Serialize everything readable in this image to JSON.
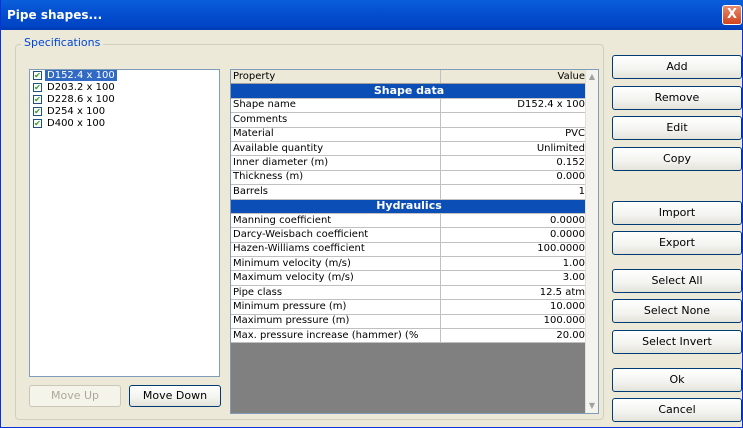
{
  "window": {
    "title": "Pipe shapes...",
    "close_glyph": "X"
  },
  "group": {
    "label": "Specifications"
  },
  "shape_list": [
    {
      "label": "D152.4 x 100",
      "checked": true,
      "selected": true
    },
    {
      "label": "D203.2 x 100",
      "checked": true,
      "selected": false
    },
    {
      "label": "D228.6 x 100",
      "checked": true,
      "selected": false
    },
    {
      "label": "D254 x 100",
      "checked": true,
      "selected": false
    },
    {
      "label": "D400 x 100",
      "checked": true,
      "selected": false
    }
  ],
  "list_buttons": {
    "move_up": "Move Up",
    "move_down": "Move Down"
  },
  "grid": {
    "header": {
      "property": "Property",
      "value": "Value"
    },
    "rows": [
      {
        "section": "Shape data"
      },
      {
        "property": "Shape name",
        "value": "D152.4 x 100"
      },
      {
        "property": "Comments",
        "value": ""
      },
      {
        "property": "Material",
        "value": "PVC"
      },
      {
        "property": "Available quantity",
        "value": "Unlimited"
      },
      {
        "property": "Inner diameter (m)",
        "value": "0.152"
      },
      {
        "property": "Thickness (m)",
        "value": "0.000"
      },
      {
        "property": "Barrels",
        "value": "1"
      },
      {
        "section": "Hydraulics"
      },
      {
        "property": "Manning coefficient",
        "value": "0.0000"
      },
      {
        "property": "Darcy-Weisbach coefficient",
        "value": "0.0000"
      },
      {
        "property": "Hazen-Williams coefficient",
        "value": "100.0000"
      },
      {
        "property": "Minimum velocity (m/s)",
        "value": "1.00"
      },
      {
        "property": "Maximum velocity (m/s)",
        "value": "3.00"
      },
      {
        "property": "Pipe class",
        "value": "12.5 atm"
      },
      {
        "property": "Minimum pressure (m)",
        "value": "10.000"
      },
      {
        "property": "Maximum pressure (m)",
        "value": "100.000"
      },
      {
        "property": "Max. pressure increase (hammer) (%",
        "value": "20.00"
      }
    ]
  },
  "side_buttons": {
    "add": "Add",
    "remove": "Remove",
    "edit": "Edit",
    "copy": "Copy",
    "import": "Import",
    "export": "Export",
    "select_all": "Select All",
    "select_none": "Select None",
    "select_invert": "Select Invert",
    "ok": "Ok",
    "cancel": "Cancel"
  },
  "icons": {
    "check": "check-icon",
    "scroll_up": "scroll-up-arrow-icon",
    "scroll_down": "scroll-down-arrow-icon"
  },
  "colors": {
    "titlebar": "#0A5FDB",
    "section_header": "#0A4EB6",
    "selection": "#316AC5",
    "group_label": "#0046D5"
  }
}
